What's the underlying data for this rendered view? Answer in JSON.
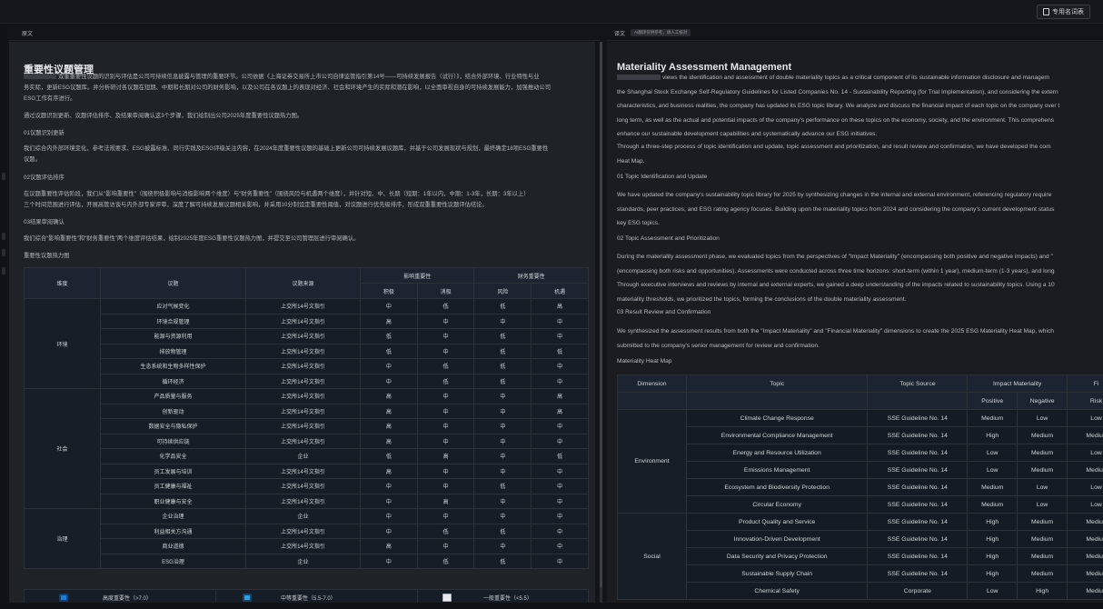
{
  "toolbar": {
    "glossary_label": "专用名词表"
  },
  "source": {
    "header": "原文",
    "title": "重要性议题管理",
    "intro": "双重重要性议题的识别与评估是公司可持续信息披露与管理的重要环节。公司依据《上海证券交易所上市公司自律监管指引第14号——可持续发展报告（试行）》，结合外部环境、行业特性与业务实际，更新ESG议题库。并分析研讨各议题在短期、中期和长期对公司的财务影响，以及公司在各议题上的表现对经济、社会和环境产生的实际和潜在影响，以全面审视自身的可持续发展能力，加强推动公司ESG工作有序进行。",
    "intro_lines": [
      "双重重要性议题的识别与评估是公司可持续信息披露与管理的重要环节。公司依据《上海证券交易所上市公司自律监管指引第14号——可持续发展报告（试行）》，结合外部环境、行业特性与业",
      "务实际，更新ESG议题库。并分析研讨各议题在短期、中期和长期对公司的财务影响，以及公司在各议题上的表现对经济、社会和环境产生的实际和潜在影响，以全面审视自身的可持续发展能力，加强推动公司",
      "ESG工作有序进行。"
    ],
    "process": "通过议题识别更新、议题评估排序、及结果审阅确认这3个步骤，我们绘制出公司2025年度重要性议题热力图。",
    "step1_title": "01议题识别更新",
    "step1_lines": [
      "我们综合内外部环境变化，参考法规要求、ESG披露标准、同行实践及ESG评级关注内容，在2024年度重要性议题的基础上更新公司可持续发展议题库，并基于公司发展现状与规划，最终确定18项ESG重要性",
      "议题。"
    ],
    "step2_title": "02议题评估排序",
    "step2_lines": [
      "在议题重要性评估阶段，我们从“影响重要性”（围绕积极影响与消极影响两个维度）与“财务重要性”（围绕风险与机遇两个维度），并针对短、中、长期（短期：1年以内，中期：1-3年，长期：3年以上）",
      "三个时间范围进行评估，开展高管访谈与内外部专家评审，深度了解可持续发展议题相关影响，并采用10分制设定重要性阈值，对议题进行优先级排序，形成双重重要性议题评估结论。"
    ],
    "step3_title": "03结果审阅确认",
    "step3": "我们综合“影响重要性”和“财务重要性”两个维度评估结果，绘制2025年度ESG重要性议题热力图，并提交至公司管理层进行审阅确认。",
    "heatmap_title": "重要性议题热力图",
    "table": {
      "headers": [
        "维度",
        "议题",
        "议题来源",
        "影响重要性",
        "财务重要性"
      ],
      "subheaders": [
        "积极",
        "消极",
        "风险",
        "机遇"
      ],
      "groups": [
        {
          "dimension": "环境",
          "rows": [
            [
              "应对气候变化",
              "上交所14号文指引",
              "中",
              "低",
              "低",
              "高"
            ],
            [
              "环境合规管理",
              "上交所14号文指引",
              "高",
              "中",
              "中",
              "中"
            ],
            [
              "能源与资源利用",
              "上交所14号文指引",
              "低",
              "中",
              "低",
              "中"
            ],
            [
              "排放物管理",
              "上交所14号文指引",
              "低",
              "中",
              "低",
              "低"
            ],
            [
              "生态系统和生物多样性保护",
              "上交所14号文指引",
              "中",
              "低",
              "低",
              "中"
            ],
            [
              "循环经济",
              "上交所14号文指引",
              "中",
              "低",
              "低",
              "中"
            ]
          ]
        },
        {
          "dimension": "社会",
          "rows": [
            [
              "产品质量与服务",
              "上交所14号文指引",
              "高",
              "中",
              "中",
              "高"
            ],
            [
              "创新驱动",
              "上交所14号文指引",
              "高",
              "中",
              "中",
              "高"
            ],
            [
              "数据安全与隐私保护",
              "上交所14号文指引",
              "高",
              "中",
              "中",
              "中"
            ],
            [
              "可持续供应链",
              "上交所14号文指引",
              "高",
              "中",
              "中",
              "中"
            ],
            [
              "化学品安全",
              "企业",
              "低",
              "高",
              "中",
              "低"
            ],
            [
              "员工发展与培训",
              "上交所14号文指引",
              "高",
              "中",
              "中",
              "中"
            ],
            [
              "员工健康与福祉",
              "上交所14号文指引",
              "中",
              "中",
              "低",
              "中"
            ],
            [
              "职业健康与安全",
              "上交所14号文指引",
              "中",
              "高",
              "中",
              "中"
            ]
          ]
        },
        {
          "dimension": "治理",
          "rows": [
            [
              "企业治理",
              "企业",
              "中",
              "中",
              "中",
              "中"
            ],
            [
              "利益相关方沟通",
              "上交所14号文指引",
              "中",
              "低",
              "低",
              "中"
            ],
            [
              "商业道德",
              "上交所14号文指引",
              "高",
              "中",
              "中",
              "中"
            ],
            [
              "ESG治理",
              "企业",
              "中",
              "低",
              "低",
              "中"
            ]
          ]
        }
      ]
    },
    "legend": {
      "high": "高度重要性（>7.0）",
      "mid": "中等重要性（5.5-7.0）",
      "low": "一般重要性（<5.5）"
    }
  },
  "translation": {
    "header": "译文",
    "hint": "AI翻译仅供参考，请人工核对",
    "title": "Materiality Assessment Management",
    "intro_lines": [
      "views the identification and assessment of double materiality topics as a critical component of its sustainable information disclosure and managem",
      "the Shanghai Stock Exchange Self-Regulatory Guidelines for Listed Companies No. 14 - Sustainability Reporting (for Trial Implementation), and considering the extern",
      "characteristics, and business realities, the company has updated its ESG topic library. We analyze and discuss the financial impact of each topic on the company over t",
      "long term, as well as the actual and potential impacts of the company's performance on these topics on the economy, society, and the environment. This comprehens",
      "enhance our sustainable development capabilities and systematically advance our ESG initiatives."
    ],
    "process_lines": [
      "Through a three-step process of topic identification and update, topic assessment and prioritization, and result review and confirmation, we have developed the com",
      "Heat Map."
    ],
    "step1_title": "01 Topic Identification and Update",
    "step1_lines": [
      "We have updated the company's sustainability topic library for 2025 by synthesizing changes in the internal and external environment, referencing regulatory require",
      "standards, peer practices, and ESG rating agency focuses. Building upon the materiality topics from 2024 and considering the company's current development status",
      "key ESG topics."
    ],
    "step2_title": "02 Topic Assessment and Prioritization",
    "step2_lines": [
      "During the materiality assessment phase, we evaluated topics from the perspectives of \"Impact Materiality\" (encompassing both positive and negative impacts) and \"",
      "(encompassing both risks and opportunities). Assessments were conducted across three time horizons: short-term (within 1 year), medium-term (1-3 years), and long",
      "Through executive interviews and reviews by internal and external experts, we gained a deep understanding of the impacts related to sustainability topics. Using a 10",
      "materiality thresholds, we prioritized the topics, forming the conclusions of the double materiality assessment."
    ],
    "step3_title": "03 Result Review and Confirmation",
    "step3_lines": [
      "We synthesized the assessment results from both the \"Impact Materiality\" and \"Financial Materiality\" dimensions to create the 2025 ESG Materiality Heat Map, which",
      "submitted to the company's senior management for review and confirmation."
    ],
    "heatmap_title": "Materiality Heat Map",
    "table": {
      "headers": [
        "Dimension",
        "Topic",
        "Topic Source",
        "Impact Materiality",
        "Fi"
      ],
      "subheaders": [
        "Positive",
        "Negative",
        "Risk"
      ],
      "groups": [
        {
          "dimension": "Environment",
          "rows": [
            [
              "Climate Change Response",
              "SSE Guideline No. 14",
              "Medium",
              "Low",
              "Low"
            ],
            [
              "Environmental Compliance Management",
              "SSE Guideline No. 14",
              "High",
              "Medium",
              "Mediun"
            ],
            [
              "Energy and Resource Utilization",
              "SSE Guideline No. 14",
              "Low",
              "Medium",
              "Low"
            ],
            [
              "Emissions Management",
              "SSE Guideline No. 14",
              "Low",
              "Medium",
              "Mediun"
            ],
            [
              "Ecosystem and Biodiversity Protection",
              "SSE Guideline No. 14",
              "Medium",
              "Low",
              "Low"
            ],
            [
              "Circular Economy",
              "SSE Guideline No. 14",
              "Medium",
              "Low",
              "Low"
            ]
          ]
        },
        {
          "dimension": "Social",
          "rows": [
            [
              "Product Quality and Service",
              "SSE Guideline No. 14",
              "High",
              "Medium",
              "Mediun"
            ],
            [
              "Innovation-Driven Development",
              "SSE Guideline No. 14",
              "High",
              "Medium",
              "Mediun"
            ],
            [
              "Data Security and Privacy Protection",
              "SSE Guideline No. 14",
              "High",
              "Medium",
              "Mediun"
            ],
            [
              "Sustainable Supply Chain",
              "SSE Guideline No. 14",
              "High",
              "Medium",
              "Mediun"
            ],
            [
              "Chemical Safety",
              "Corporate",
              "Low",
              "High",
              "Mediun"
            ]
          ]
        }
      ]
    }
  }
}
